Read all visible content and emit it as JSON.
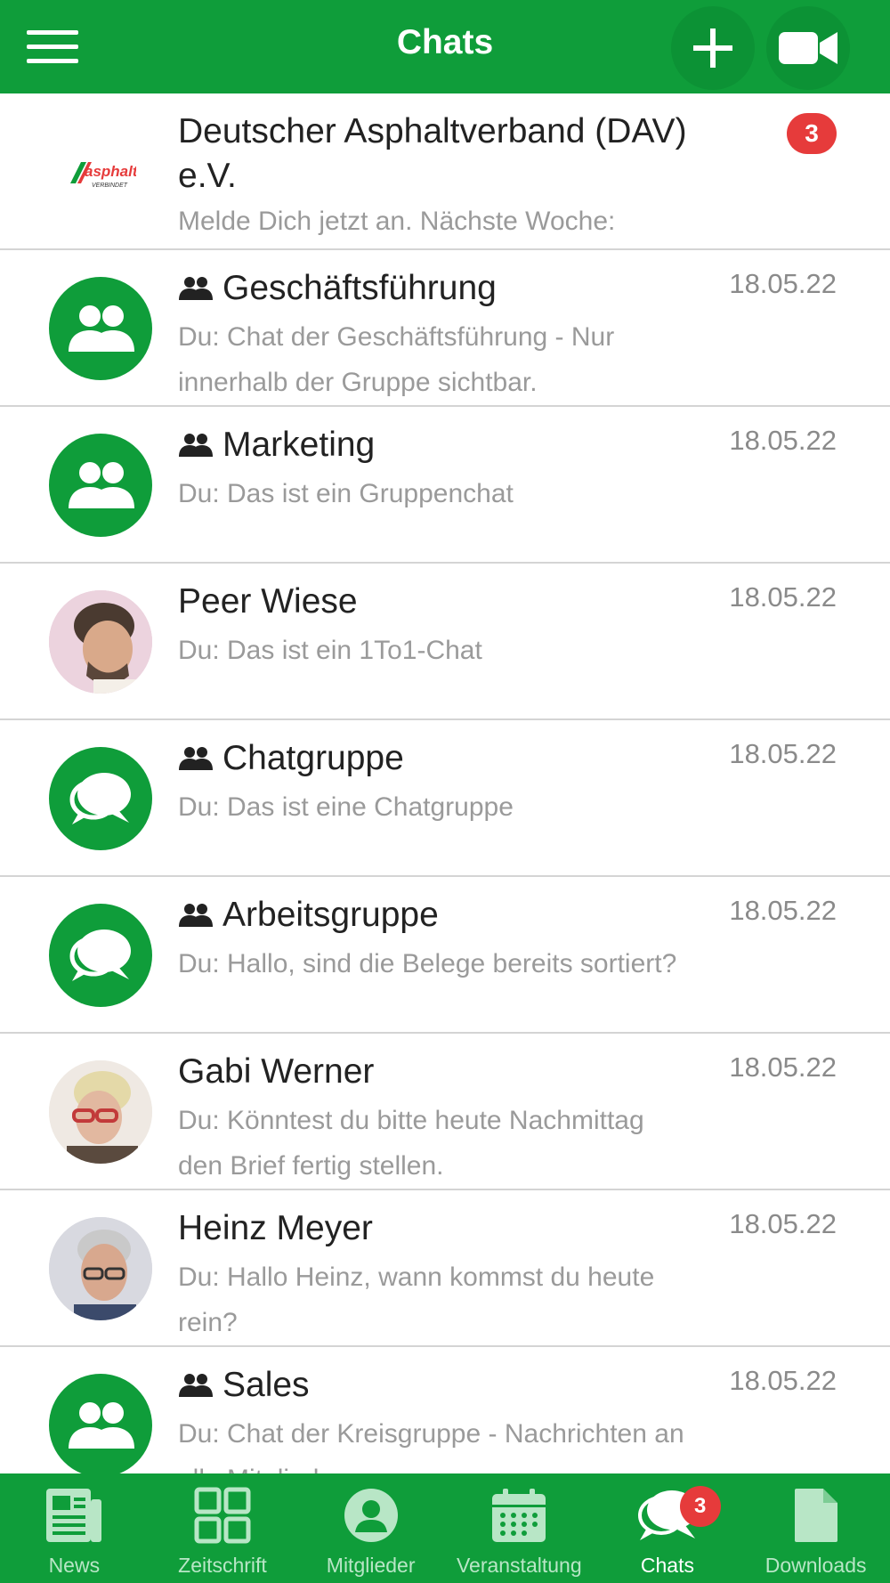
{
  "header": {
    "title": "Chats"
  },
  "chats": [
    {
      "title": "Deutscher Asphaltverband (DAV) e.V.",
      "title_line1": "Deutscher Asphaltverband (DAV)",
      "title_line2": "e.V.",
      "preview": "Melde Dich jetzt an. Nächste Woche:",
      "unread": "3",
      "logo_text": "asphalt",
      "logo_subtext": "VERBINDET"
    },
    {
      "title": "Geschäftsführung",
      "preview": "Du: Chat der Geschäftsführung - Nur innerhalb der Gruppe sichtbar.",
      "date": "18.05.22",
      "group": true,
      "avatar": "group-icon"
    },
    {
      "title": "Marketing",
      "preview": "Du: Das ist ein Gruppenchat",
      "date": "18.05.22",
      "group": true,
      "avatar": "group-icon"
    },
    {
      "title": "Peer Wiese",
      "preview": "Du: Das ist ein 1To1-Chat",
      "date": "18.05.22",
      "group": false,
      "avatar": "photo"
    },
    {
      "title": "Chatgruppe",
      "preview": "Du: Das ist eine Chatgruppe",
      "date": "18.05.22",
      "group": true,
      "avatar": "chat-bubbles-icon"
    },
    {
      "title": "Arbeitsgruppe",
      "preview": "Du: Hallo, sind die Belege bereits sortiert?",
      "date": "18.05.22",
      "group": true,
      "avatar": "chat-bubbles-icon"
    },
    {
      "title": "Gabi Werner",
      "preview": "Du: Könntest du bitte heute Nachmittag den Brief fertig stellen.",
      "date": "18.05.22",
      "group": false,
      "avatar": "photo"
    },
    {
      "title": "Heinz Meyer",
      "preview": "Du: Hallo Heinz, wann kommst du heute rein?",
      "date": "18.05.22",
      "group": false,
      "avatar": "photo"
    },
    {
      "title": "Sales",
      "preview": "Du: Chat der Kreisgruppe - Nachrichten an alle Mitglieder",
      "date": "18.05.22",
      "group": true,
      "avatar": "group-icon"
    }
  ],
  "tabs": [
    {
      "label": "News",
      "icon": "newspaper-icon"
    },
    {
      "label": "Zeitschrift",
      "icon": "grid-icon"
    },
    {
      "label": "Mitglieder",
      "icon": "person-icon"
    },
    {
      "label": "Veranstaltung",
      "icon": "calendar-icon"
    },
    {
      "label": "Chats",
      "icon": "chat-icon",
      "badge": "3",
      "active": true
    },
    {
      "label": "Downloads",
      "icon": "file-icon"
    }
  ],
  "colors": {
    "brand": "#0f9d3a",
    "badge": "#e63b3b",
    "muted": "#9a9a9a"
  }
}
